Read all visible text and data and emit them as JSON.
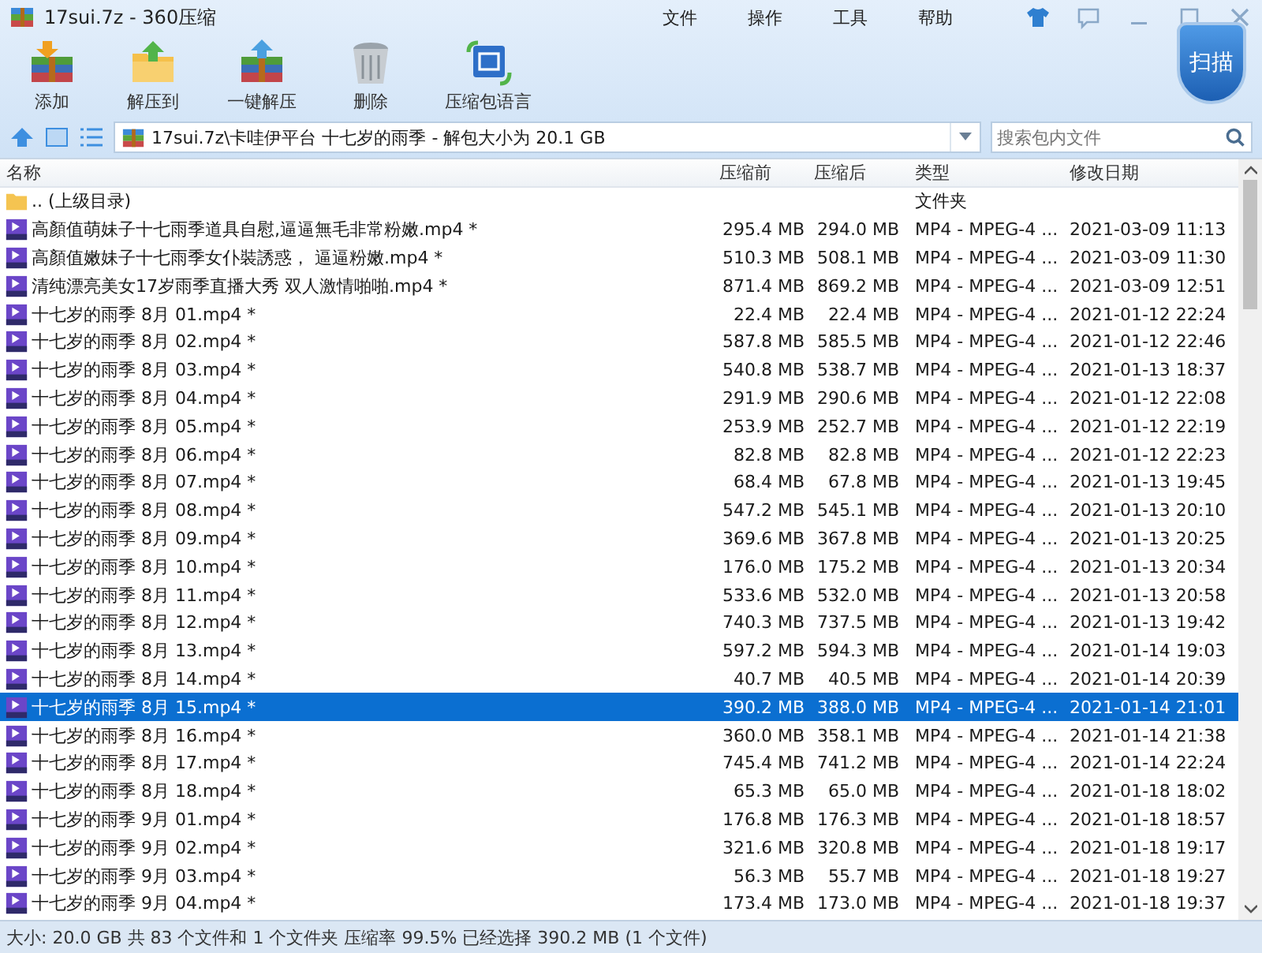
{
  "window": {
    "title": "17sui.7z - 360压缩"
  },
  "menu": [
    "文件",
    "操作",
    "工具",
    "帮助"
  ],
  "toolbar": [
    "添加",
    "解压到",
    "一键解压",
    "删除",
    "压缩包语言"
  ],
  "scan_button": "扫描",
  "address": {
    "path": "17sui.7z\\卡哇伊平台 十七岁的雨季 - 解包大小为 20.1 GB"
  },
  "search": {
    "placeholder": "搜索包内文件"
  },
  "table": {
    "columns": [
      "名称",
      "压缩前",
      "压缩后",
      "类型",
      "修改日期"
    ],
    "rows": [
      {
        "kind": "folder",
        "name": ".. (上级目录)",
        "before": "",
        "after": "",
        "type": "文件夹",
        "date": "",
        "selected": false
      },
      {
        "kind": "video",
        "name": "高顏值萌妹子十七雨季道具自慰,逼逼無毛非常粉嫩.mp4 *",
        "before": "295.4 MB",
        "after": "294.0 MB",
        "type": "MP4 - MPEG-4 ...",
        "date": "2021-03-09 11:13",
        "selected": false
      },
      {
        "kind": "video",
        "name": "高顏值嫩妹子十七雨季女仆裝誘惑， 逼逼粉嫩.mp4 *",
        "before": "510.3 MB",
        "after": "508.1 MB",
        "type": "MP4 - MPEG-4 ...",
        "date": "2021-03-09 11:30",
        "selected": false
      },
      {
        "kind": "video",
        "name": "清纯漂亮美女17岁雨季直播大秀 双人激情啪啪.mp4 *",
        "before": "871.4 MB",
        "after": "869.2 MB",
        "type": "MP4 - MPEG-4 ...",
        "date": "2021-03-09 12:51",
        "selected": false
      },
      {
        "kind": "video",
        "name": "十七岁的雨季 8月 01.mp4 *",
        "before": "22.4 MB",
        "after": "22.4 MB",
        "type": "MP4 - MPEG-4 ...",
        "date": "2021-01-12 22:24",
        "selected": false
      },
      {
        "kind": "video",
        "name": "十七岁的雨季 8月 02.mp4 *",
        "before": "587.8 MB",
        "after": "585.5 MB",
        "type": "MP4 - MPEG-4 ...",
        "date": "2021-01-12 22:46",
        "selected": false
      },
      {
        "kind": "video",
        "name": "十七岁的雨季 8月 03.mp4 *",
        "before": "540.8 MB",
        "after": "538.7 MB",
        "type": "MP4 - MPEG-4 ...",
        "date": "2021-01-13 18:37",
        "selected": false
      },
      {
        "kind": "video",
        "name": "十七岁的雨季 8月 04.mp4 *",
        "before": "291.9 MB",
        "after": "290.6 MB",
        "type": "MP4 - MPEG-4 ...",
        "date": "2021-01-12 22:08",
        "selected": false
      },
      {
        "kind": "video",
        "name": "十七岁的雨季 8月 05.mp4 *",
        "before": "253.9 MB",
        "after": "252.7 MB",
        "type": "MP4 - MPEG-4 ...",
        "date": "2021-01-12 22:19",
        "selected": false
      },
      {
        "kind": "video",
        "name": "十七岁的雨季 8月 06.mp4 *",
        "before": "82.8 MB",
        "after": "82.8 MB",
        "type": "MP4 - MPEG-4 ...",
        "date": "2021-01-12 22:23",
        "selected": false
      },
      {
        "kind": "video",
        "name": "十七岁的雨季 8月 07.mp4 *",
        "before": "68.4 MB",
        "after": "67.8 MB",
        "type": "MP4 - MPEG-4 ...",
        "date": "2021-01-13 19:45",
        "selected": false
      },
      {
        "kind": "video",
        "name": "十七岁的雨季 8月 08.mp4 *",
        "before": "547.2 MB",
        "after": "545.1 MB",
        "type": "MP4 - MPEG-4 ...",
        "date": "2021-01-13 20:10",
        "selected": false
      },
      {
        "kind": "video",
        "name": "十七岁的雨季 8月 09.mp4 *",
        "before": "369.6 MB",
        "after": "367.8 MB",
        "type": "MP4 - MPEG-4 ...",
        "date": "2021-01-13 20:25",
        "selected": false
      },
      {
        "kind": "video",
        "name": "十七岁的雨季 8月 10.mp4 *",
        "before": "176.0 MB",
        "after": "175.2 MB",
        "type": "MP4 - MPEG-4 ...",
        "date": "2021-01-13 20:34",
        "selected": false
      },
      {
        "kind": "video",
        "name": "十七岁的雨季 8月 11.mp4 *",
        "before": "533.6 MB",
        "after": "532.0 MB",
        "type": "MP4 - MPEG-4 ...",
        "date": "2021-01-13 20:58",
        "selected": false
      },
      {
        "kind": "video",
        "name": "十七岁的雨季 8月 12.mp4 *",
        "before": "740.3 MB",
        "after": "737.5 MB",
        "type": "MP4 - MPEG-4 ...",
        "date": "2021-01-13 19:42",
        "selected": false
      },
      {
        "kind": "video",
        "name": "十七岁的雨季 8月 13.mp4 *",
        "before": "597.2 MB",
        "after": "594.3 MB",
        "type": "MP4 - MPEG-4 ...",
        "date": "2021-01-14 19:03",
        "selected": false
      },
      {
        "kind": "video",
        "name": "十七岁的雨季 8月 14.mp4 *",
        "before": "40.7 MB",
        "after": "40.5 MB",
        "type": "MP4 - MPEG-4 ...",
        "date": "2021-01-14 20:39",
        "selected": false
      },
      {
        "kind": "video",
        "name": "十七岁的雨季 8月 15.mp4 *",
        "before": "390.2 MB",
        "after": "388.0 MB",
        "type": "MP4 - MPEG-4 ...",
        "date": "2021-01-14 21:01",
        "selected": true
      },
      {
        "kind": "video",
        "name": "十七岁的雨季 8月 16.mp4 *",
        "before": "360.0 MB",
        "after": "358.1 MB",
        "type": "MP4 - MPEG-4 ...",
        "date": "2021-01-14 21:38",
        "selected": false
      },
      {
        "kind": "video",
        "name": "十七岁的雨季 8月 17.mp4 *",
        "before": "745.4 MB",
        "after": "741.2 MB",
        "type": "MP4 - MPEG-4 ...",
        "date": "2021-01-14 22:24",
        "selected": false
      },
      {
        "kind": "video",
        "name": "十七岁的雨季 8月 18.mp4 *",
        "before": "65.3 MB",
        "after": "65.0 MB",
        "type": "MP4 - MPEG-4 ...",
        "date": "2021-01-18 18:02",
        "selected": false
      },
      {
        "kind": "video",
        "name": "十七岁的雨季 9月 01.mp4 *",
        "before": "176.8 MB",
        "after": "176.3 MB",
        "type": "MP4 - MPEG-4 ...",
        "date": "2021-01-18 18:57",
        "selected": false
      },
      {
        "kind": "video",
        "name": "十七岁的雨季 9月 02.mp4 *",
        "before": "321.6 MB",
        "after": "320.8 MB",
        "type": "MP4 - MPEG-4 ...",
        "date": "2021-01-18 19:17",
        "selected": false
      },
      {
        "kind": "video",
        "name": "十七岁的雨季 9月 03.mp4 *",
        "before": "56.3 MB",
        "after": "55.7 MB",
        "type": "MP4 - MPEG-4 ...",
        "date": "2021-01-18 19:27",
        "selected": false
      },
      {
        "kind": "video",
        "name": "十七岁的雨季 9月 04.mp4 *",
        "before": "173.4 MB",
        "after": "173.0 MB",
        "type": "MP4 - MPEG-4 ...",
        "date": "2021-01-18 19:37",
        "selected": false
      }
    ]
  },
  "status_bar": "大小: 20.0 GB 共 83 个文件和 1 个文件夹 压缩率 99.5% 已经选择 390.2 MB (1 个文件)"
}
